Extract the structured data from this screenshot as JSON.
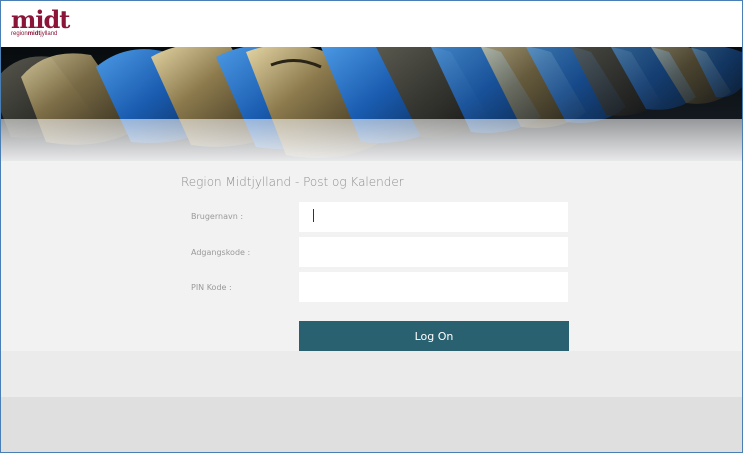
{
  "logo": {
    "brand": "midt",
    "subtitle_prefix": "region",
    "subtitle_bold": "midt",
    "subtitle_suffix": "jylland"
  },
  "form": {
    "title": "Region Midtjylland - Post og Kalender",
    "username_label": "Brugernavn :",
    "password_label": "Adgangskode :",
    "pin_label": "PIN Kode :",
    "username_value": "",
    "password_value": "",
    "pin_value": "",
    "logon_label": "Log On"
  },
  "icons": {
    "banner": "keyboard-keys-photo"
  },
  "colors": {
    "brand": "#8a1538",
    "button": "#2a6170",
    "frame_border": "#4a7fb5",
    "form_bg": "#f2f2f2"
  }
}
